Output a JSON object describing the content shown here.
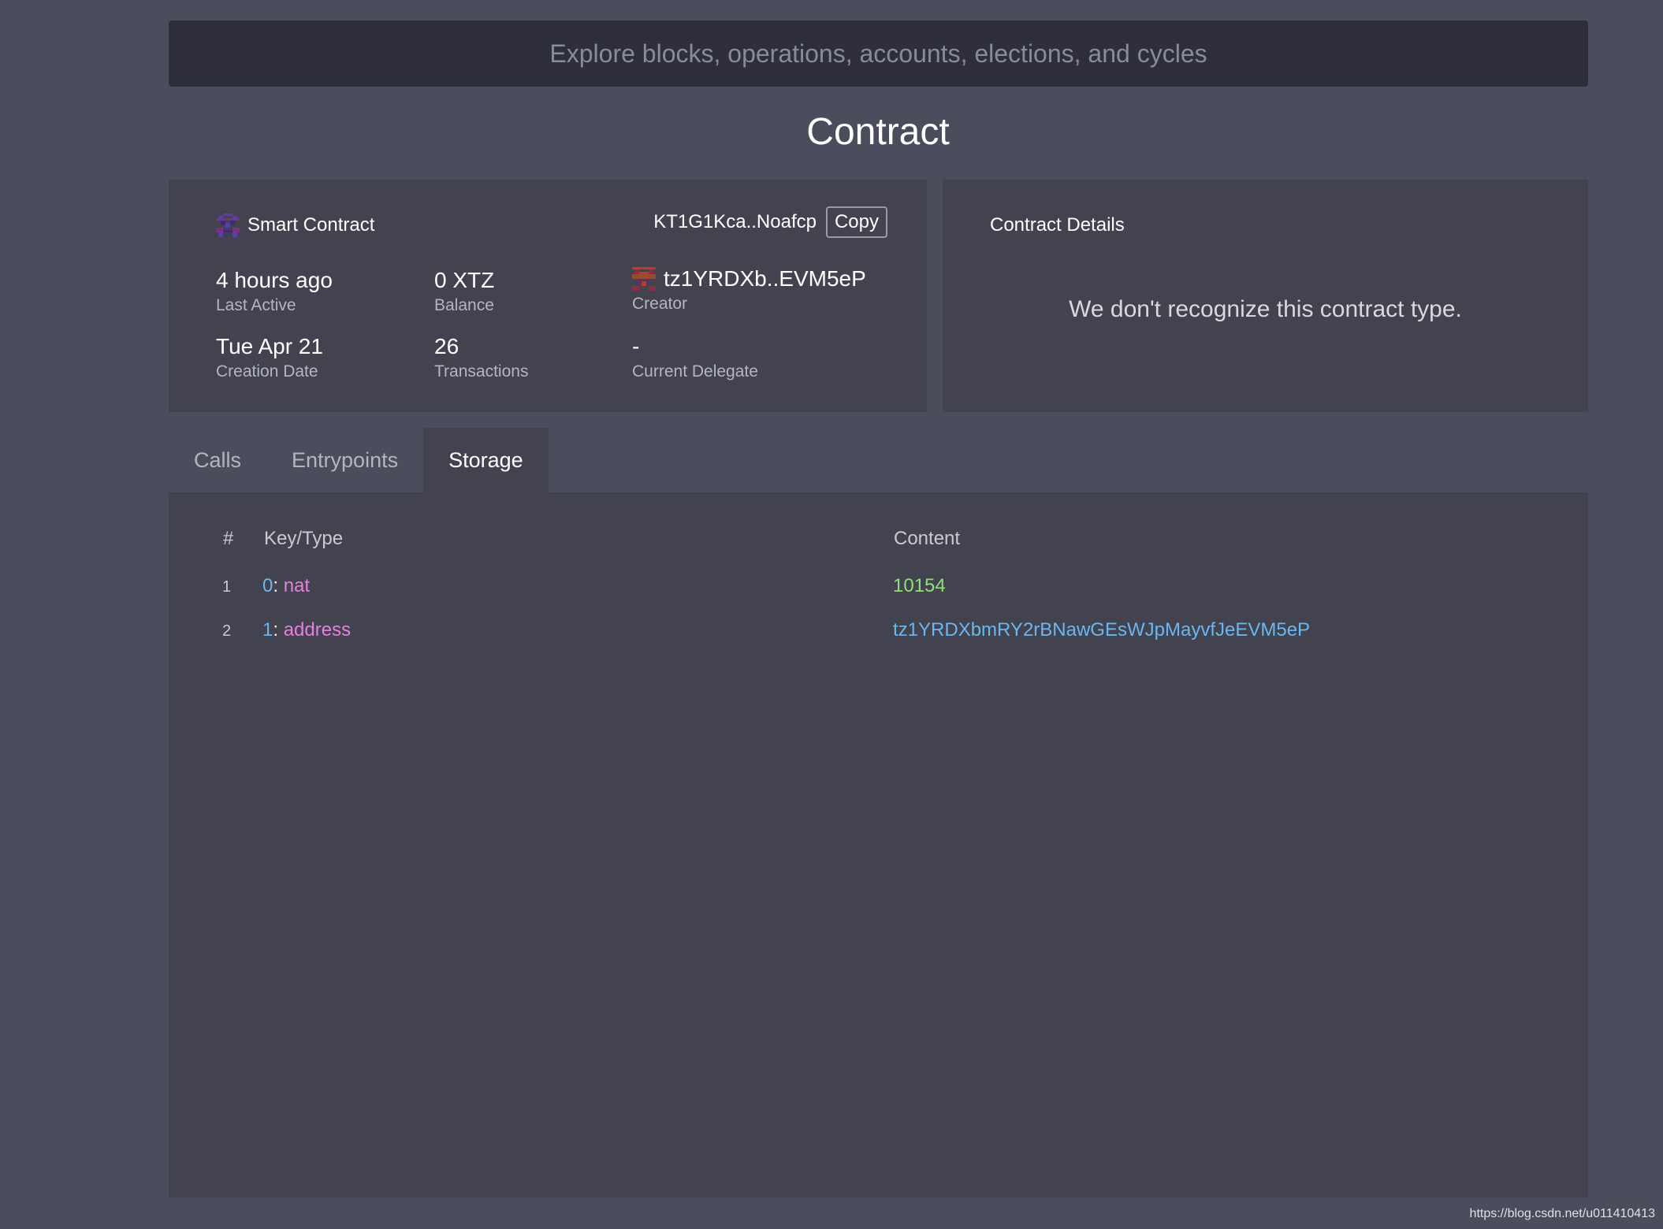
{
  "search": {
    "placeholder": "Explore blocks, operations, accounts, elections, and cycles"
  },
  "page_title": "Contract",
  "contract": {
    "type_label": "Smart Contract",
    "address_short": "KT1G1Kca..Noafcp",
    "copy_label": "Copy",
    "stats": {
      "last_active": {
        "value": "4 hours ago",
        "label": "Last Active"
      },
      "balance": {
        "value": "0 XTZ",
        "label": "Balance"
      },
      "creator": {
        "value": "tz1YRDXb..EVM5eP",
        "label": "Creator"
      },
      "creation_date": {
        "value": "Tue Apr 21",
        "label": "Creation Date"
      },
      "transactions": {
        "value": "26",
        "label": "Transactions"
      },
      "delegate": {
        "value": "-",
        "label": "Current Delegate"
      }
    }
  },
  "details": {
    "title": "Contract Details",
    "message": "We don't recognize this contract type."
  },
  "tabs": [
    {
      "label": "Calls",
      "active": false
    },
    {
      "label": "Entrypoints",
      "active": false
    },
    {
      "label": "Storage",
      "active": true
    }
  ],
  "storage": {
    "headers": {
      "num": "#",
      "key": "Key/Type",
      "content": "Content"
    },
    "rows": [
      {
        "num": "1",
        "key_index": "0",
        "colon": ":",
        "key_type": "nat",
        "content": "10154"
      },
      {
        "num": "2",
        "key_index": "1",
        "colon": ":",
        "key_type": "address",
        "content": "tz1YRDXbmRY2rBNawGEsWJpMayvfJeEVM5eP"
      }
    ]
  },
  "watermark": "https://blog.csdn.net/u011410413",
  "colors": {
    "background": "#4b4d5c",
    "panel": "#42434f",
    "search_bg": "#2f2f3b",
    "key_index": "#6ab7f0",
    "key_type": "#e77fe0",
    "nat_value": "#8fe07a",
    "address_value": "#6ab7f0"
  },
  "icons": {
    "contract_avatar": "identicon-purple",
    "creator_avatar": "identicon-red"
  }
}
